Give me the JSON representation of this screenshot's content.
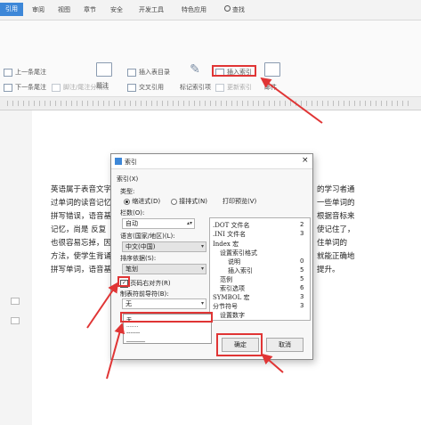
{
  "menubar": {
    "items": [
      "引用",
      "审阅",
      "视图",
      "章节",
      "安全",
      "开发工具",
      "特色应用",
      "查找"
    ],
    "active_index": 0
  },
  "ribbon": {
    "prev_footnote": "上一条尾注",
    "next_footnote": "下一条尾注",
    "footnote_caret": "脚注/尾注分隔线",
    "insert_table_caption": "插入表目录",
    "caption": "题注",
    "cross_reference": "交叉引用",
    "mark_index": "标记索引项",
    "insert_index": "插入索引",
    "update_index": "更新索引",
    "mail": "邮件"
  },
  "document": {
    "lines": [
      "英语属于表音文字",
      "过单词的读音记忆",
      "拼写错误，语音基",
      "记忆，尚是 反复",
      "也很容易忘掉，因",
      "方法，使学生背诵",
      "拼写单词，语音基"
    ],
    "right_lines": [
      "的学习者通",
      "一些单词的",
      "根据音标来",
      "使记住了，",
      "住单词的",
      "就能正确地",
      "提升。"
    ]
  },
  "dialog": {
    "title": "索引",
    "section": "索引(X)",
    "type_label": "类型:",
    "type_indent": "缩进式(D)",
    "type_runin": "接排式(N)",
    "print_preview": "打印预览(V)",
    "columns_label": "栏数(O):",
    "columns_value": "自动",
    "language_label": "语言(国家/地区)(L):",
    "language_value": "中文(中国)",
    "sort_label": "排序依据(S):",
    "sort_value": "笔划",
    "align_right": "页码右对齐(R)",
    "leader_label": "制表符前导符(B):",
    "leader_value": "无",
    "ok": "确定",
    "cancel": "取消",
    "preview": [
      {
        "text": ".DOT 文件名",
        "page": "2"
      },
      {
        "text": ".INI 文件名",
        "page": "3"
      },
      {
        "text": "Index 宏",
        "page": ""
      },
      {
        "text": "设置索引格式",
        "page": ""
      },
      {
        "text": "说明",
        "page": "0"
      },
      {
        "text": "插入索引",
        "page": "5"
      },
      {
        "text": "范例",
        "page": "5"
      },
      {
        "text": "索引选项",
        "page": "6"
      },
      {
        "text": "SYMBOL 宏",
        "page": "3"
      },
      {
        "text": "分节符号",
        "page": "3"
      },
      {
        "text": "设置数字",
        "page": ""
      }
    ],
    "dropdown_options": [
      "无",
      ".......",
      "-------",
      "_______"
    ]
  },
  "colors": {
    "accent": "#3d87d8",
    "highlight": "#e03535"
  }
}
